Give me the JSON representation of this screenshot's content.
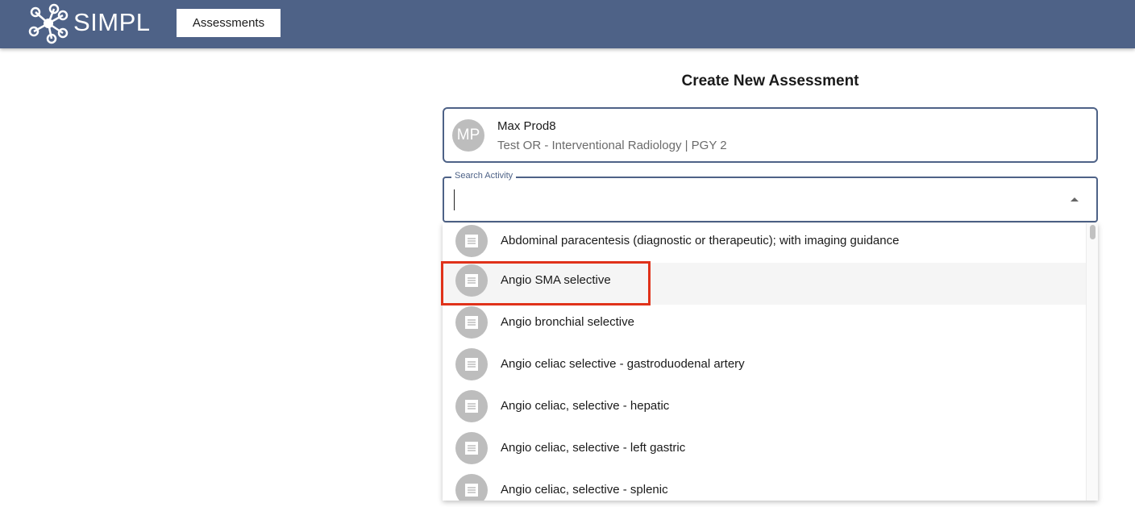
{
  "header": {
    "brand": "SIMPL",
    "nav_assessments": "Assessments",
    "colors": {
      "bar": "#4e6287",
      "highlight_box": "#e0321a"
    }
  },
  "page": {
    "title": "Create New Assessment"
  },
  "trainee": {
    "initials": "MP",
    "name": "Max Prod8",
    "details": "Test OR - Interventional Radiology | PGY 2"
  },
  "search": {
    "label": "Search Activity",
    "value": ""
  },
  "options": [
    {
      "label": "Abdominal paracentesis (diagnostic or therapeutic); with imaging guidance",
      "icon": "list-icon"
    },
    {
      "label": "Angio SMA selective",
      "icon": "list-icon",
      "highlighted": true
    },
    {
      "label": "Angio bronchial selective",
      "icon": "list-icon"
    },
    {
      "label": "Angio celiac selective - gastroduodenal artery",
      "icon": "list-icon"
    },
    {
      "label": "Angio celiac, selective - hepatic",
      "icon": "list-icon"
    },
    {
      "label": "Angio celiac, selective - left gastric",
      "icon": "list-icon"
    },
    {
      "label": "Angio celiac, selective - splenic",
      "icon": "list-icon"
    }
  ]
}
